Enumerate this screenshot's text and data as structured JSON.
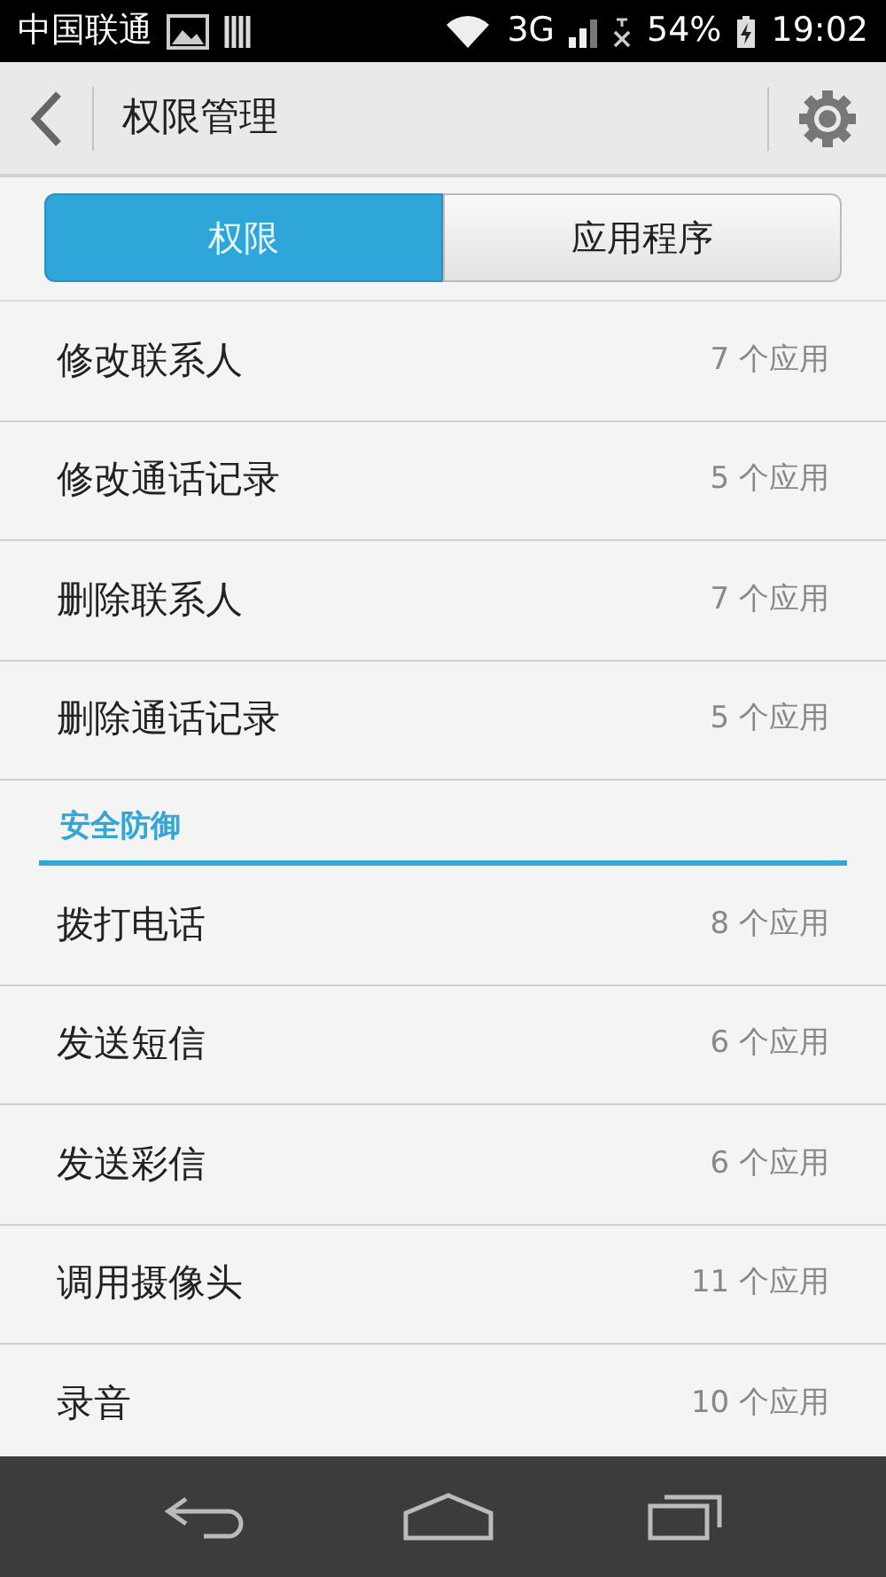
{
  "status_bar": {
    "carrier": "中国联通",
    "network": "3G",
    "battery": "54%",
    "time": "19:02"
  },
  "header": {
    "title": "权限管理"
  },
  "tabs": [
    {
      "label": "权限",
      "selected": true
    },
    {
      "label": "应用程序",
      "selected": false
    }
  ],
  "sections": [
    {
      "items": [
        {
          "name": "修改联系人",
          "count": "7 个应用"
        },
        {
          "name": "修改通话记录",
          "count": "5 个应用"
        },
        {
          "name": "删除联系人",
          "count": "7 个应用"
        },
        {
          "name": "删除通话记录",
          "count": "5 个应用"
        }
      ]
    },
    {
      "title": "安全防御",
      "items": [
        {
          "name": "拨打电话",
          "count": "8 个应用"
        },
        {
          "name": "发送短信",
          "count": "6 个应用"
        },
        {
          "name": "发送彩信",
          "count": "6 个应用"
        },
        {
          "name": "调用摄像头",
          "count": "11 个应用"
        },
        {
          "name": "录音",
          "count": "10 个应用"
        }
      ]
    }
  ]
}
